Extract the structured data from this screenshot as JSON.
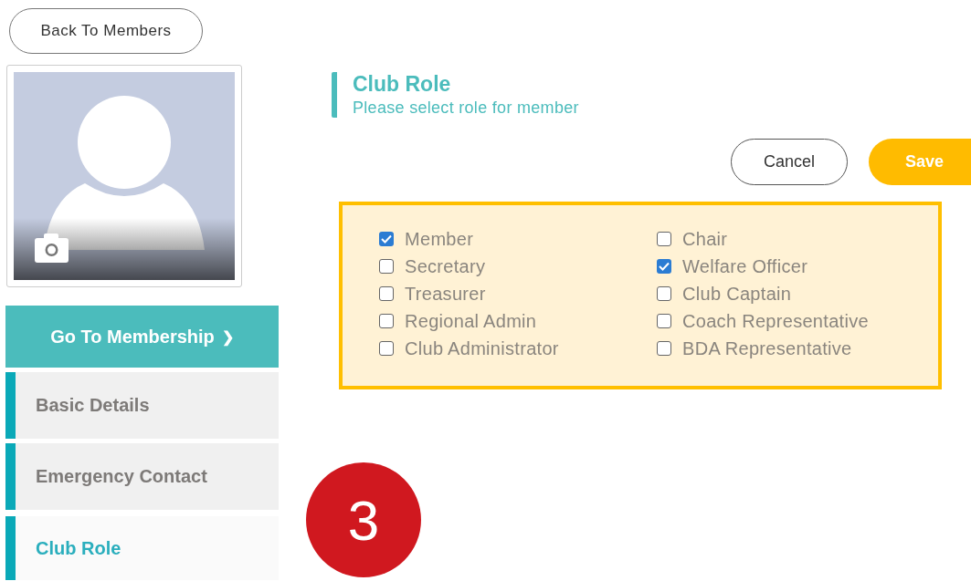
{
  "back_button": {
    "label": "Back To Members"
  },
  "sidebar": {
    "membership_button": {
      "label": "Go To Membership",
      "chevron": "❯"
    },
    "items": [
      {
        "label": "Basic Details",
        "selected": false
      },
      {
        "label": "Emergency Contact",
        "selected": false
      },
      {
        "label": "Club Role",
        "selected": true
      }
    ]
  },
  "section": {
    "title": "Club Role",
    "subtitle": "Please select role for member"
  },
  "actions": {
    "cancel": "Cancel",
    "save": "Save"
  },
  "roles": [
    {
      "label": "Member",
      "checked": true
    },
    {
      "label": "Secretary",
      "checked": false
    },
    {
      "label": "Treasurer",
      "checked": false
    },
    {
      "label": "Regional Admin",
      "checked": false
    },
    {
      "label": "Club Administrator",
      "checked": false
    },
    {
      "label": "Chair",
      "checked": false
    },
    {
      "label": "Welfare Officer",
      "checked": true
    },
    {
      "label": "Club Captain",
      "checked": false
    },
    {
      "label": "Coach Representative",
      "checked": false
    },
    {
      "label": "BDA Representative",
      "checked": false
    }
  ],
  "step_badge": "3"
}
